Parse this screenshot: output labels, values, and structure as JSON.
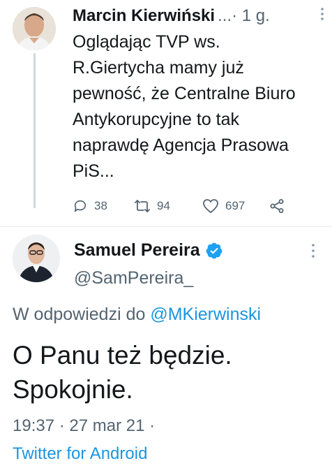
{
  "parent_tweet": {
    "author_name": "Marcin Kierwiński",
    "meta": "...· 1 g.",
    "text": "Oglądając TVP ws. R.Giertycha mamy już pewność, że Centralne Biuro Antykorupcyjne to tak naprawdę Agencja Prasowa PiS...",
    "replies": "38",
    "retweets": "94",
    "likes": "697"
  },
  "reply_tweet": {
    "author_name": "Samuel Pereira",
    "handle": "@SamPereira_",
    "reply_prefix": "W odpowiedzi do",
    "reply_mention": "@MKierwinski",
    "text": "O Panu też będzie. Spokojnie.",
    "timestamp": "19:37 · 27 mar 21 ·",
    "source": "Twitter for Android"
  },
  "colors": {
    "text": "#14171a",
    "muted": "#536471",
    "link": "#1b95e0",
    "verified": "#1da1f2"
  }
}
